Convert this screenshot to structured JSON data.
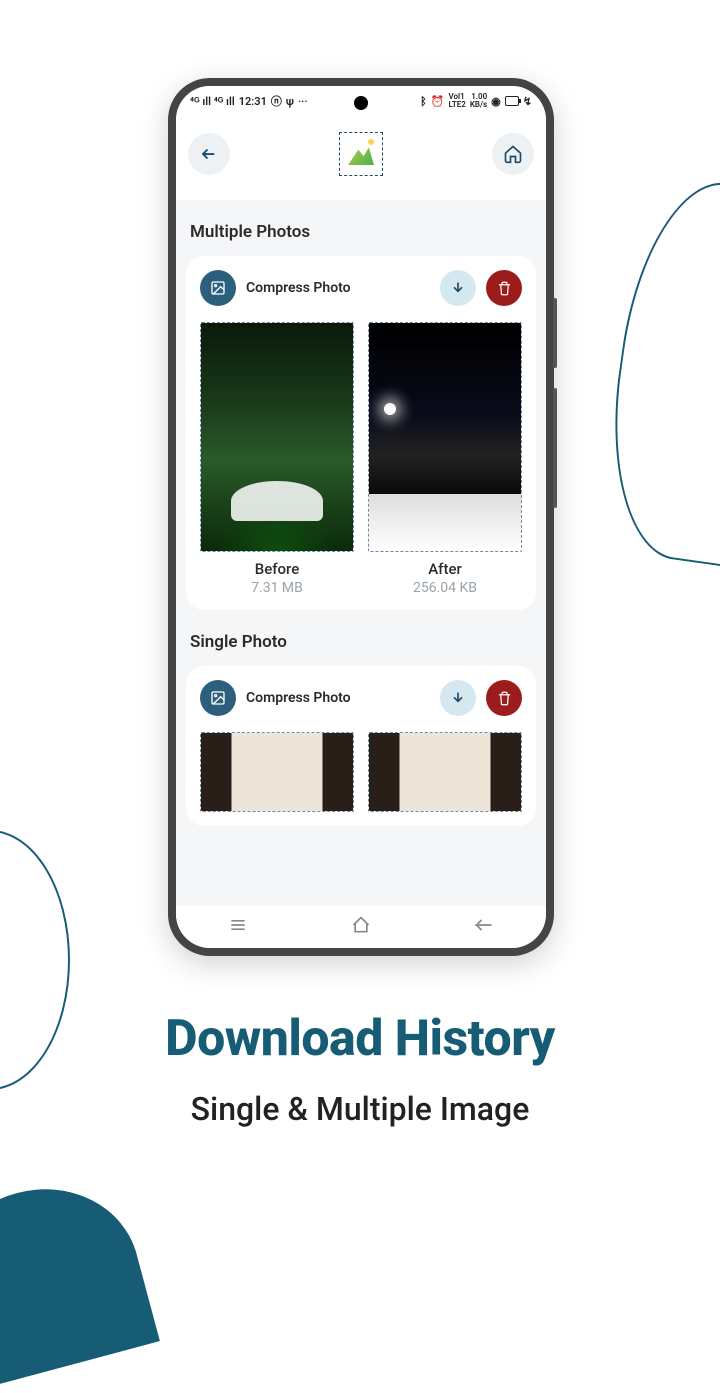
{
  "statusbar": {
    "time": "12:31",
    "net_label": "1.00",
    "net_unit": "KB/s"
  },
  "sections": {
    "multiple_title": "Multiple Photos",
    "single_title": "Single Photo"
  },
  "card1": {
    "title": "Compress Photo",
    "before_label": "Before",
    "before_size": "7.31 MB",
    "after_label": "After",
    "after_size": "256.04 KB"
  },
  "card2": {
    "title": "Compress Photo"
  },
  "promo": {
    "headline": "Download History",
    "subline": "Single & Multiple Image"
  },
  "colors": {
    "brand": "#175c75",
    "danger": "#9c1c1c",
    "bg": "#f4f6f8"
  }
}
